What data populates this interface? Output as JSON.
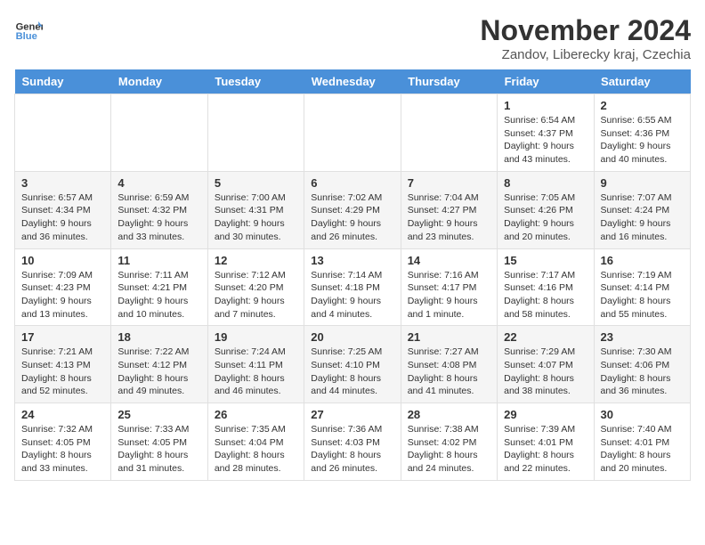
{
  "header": {
    "logo_line1": "General",
    "logo_line2": "Blue",
    "month_title": "November 2024",
    "location": "Zandov, Liberecky kraj, Czechia"
  },
  "days_of_week": [
    "Sunday",
    "Monday",
    "Tuesday",
    "Wednesday",
    "Thursday",
    "Friday",
    "Saturday"
  ],
  "weeks": [
    [
      {
        "day": "",
        "info": ""
      },
      {
        "day": "",
        "info": ""
      },
      {
        "day": "",
        "info": ""
      },
      {
        "day": "",
        "info": ""
      },
      {
        "day": "",
        "info": ""
      },
      {
        "day": "1",
        "info": "Sunrise: 6:54 AM\nSunset: 4:37 PM\nDaylight: 9 hours and 43 minutes."
      },
      {
        "day": "2",
        "info": "Sunrise: 6:55 AM\nSunset: 4:36 PM\nDaylight: 9 hours and 40 minutes."
      }
    ],
    [
      {
        "day": "3",
        "info": "Sunrise: 6:57 AM\nSunset: 4:34 PM\nDaylight: 9 hours and 36 minutes."
      },
      {
        "day": "4",
        "info": "Sunrise: 6:59 AM\nSunset: 4:32 PM\nDaylight: 9 hours and 33 minutes."
      },
      {
        "day": "5",
        "info": "Sunrise: 7:00 AM\nSunset: 4:31 PM\nDaylight: 9 hours and 30 minutes."
      },
      {
        "day": "6",
        "info": "Sunrise: 7:02 AM\nSunset: 4:29 PM\nDaylight: 9 hours and 26 minutes."
      },
      {
        "day": "7",
        "info": "Sunrise: 7:04 AM\nSunset: 4:27 PM\nDaylight: 9 hours and 23 minutes."
      },
      {
        "day": "8",
        "info": "Sunrise: 7:05 AM\nSunset: 4:26 PM\nDaylight: 9 hours and 20 minutes."
      },
      {
        "day": "9",
        "info": "Sunrise: 7:07 AM\nSunset: 4:24 PM\nDaylight: 9 hours and 16 minutes."
      }
    ],
    [
      {
        "day": "10",
        "info": "Sunrise: 7:09 AM\nSunset: 4:23 PM\nDaylight: 9 hours and 13 minutes."
      },
      {
        "day": "11",
        "info": "Sunrise: 7:11 AM\nSunset: 4:21 PM\nDaylight: 9 hours and 10 minutes."
      },
      {
        "day": "12",
        "info": "Sunrise: 7:12 AM\nSunset: 4:20 PM\nDaylight: 9 hours and 7 minutes."
      },
      {
        "day": "13",
        "info": "Sunrise: 7:14 AM\nSunset: 4:18 PM\nDaylight: 9 hours and 4 minutes."
      },
      {
        "day": "14",
        "info": "Sunrise: 7:16 AM\nSunset: 4:17 PM\nDaylight: 9 hours and 1 minute."
      },
      {
        "day": "15",
        "info": "Sunrise: 7:17 AM\nSunset: 4:16 PM\nDaylight: 8 hours and 58 minutes."
      },
      {
        "day": "16",
        "info": "Sunrise: 7:19 AM\nSunset: 4:14 PM\nDaylight: 8 hours and 55 minutes."
      }
    ],
    [
      {
        "day": "17",
        "info": "Sunrise: 7:21 AM\nSunset: 4:13 PM\nDaylight: 8 hours and 52 minutes."
      },
      {
        "day": "18",
        "info": "Sunrise: 7:22 AM\nSunset: 4:12 PM\nDaylight: 8 hours and 49 minutes."
      },
      {
        "day": "19",
        "info": "Sunrise: 7:24 AM\nSunset: 4:11 PM\nDaylight: 8 hours and 46 minutes."
      },
      {
        "day": "20",
        "info": "Sunrise: 7:25 AM\nSunset: 4:10 PM\nDaylight: 8 hours and 44 minutes."
      },
      {
        "day": "21",
        "info": "Sunrise: 7:27 AM\nSunset: 4:08 PM\nDaylight: 8 hours and 41 minutes."
      },
      {
        "day": "22",
        "info": "Sunrise: 7:29 AM\nSunset: 4:07 PM\nDaylight: 8 hours and 38 minutes."
      },
      {
        "day": "23",
        "info": "Sunrise: 7:30 AM\nSunset: 4:06 PM\nDaylight: 8 hours and 36 minutes."
      }
    ],
    [
      {
        "day": "24",
        "info": "Sunrise: 7:32 AM\nSunset: 4:05 PM\nDaylight: 8 hours and 33 minutes."
      },
      {
        "day": "25",
        "info": "Sunrise: 7:33 AM\nSunset: 4:05 PM\nDaylight: 8 hours and 31 minutes."
      },
      {
        "day": "26",
        "info": "Sunrise: 7:35 AM\nSunset: 4:04 PM\nDaylight: 8 hours and 28 minutes."
      },
      {
        "day": "27",
        "info": "Sunrise: 7:36 AM\nSunset: 4:03 PM\nDaylight: 8 hours and 26 minutes."
      },
      {
        "day": "28",
        "info": "Sunrise: 7:38 AM\nSunset: 4:02 PM\nDaylight: 8 hours and 24 minutes."
      },
      {
        "day": "29",
        "info": "Sunrise: 7:39 AM\nSunset: 4:01 PM\nDaylight: 8 hours and 22 minutes."
      },
      {
        "day": "30",
        "info": "Sunrise: 7:40 AM\nSunset: 4:01 PM\nDaylight: 8 hours and 20 minutes."
      }
    ]
  ]
}
